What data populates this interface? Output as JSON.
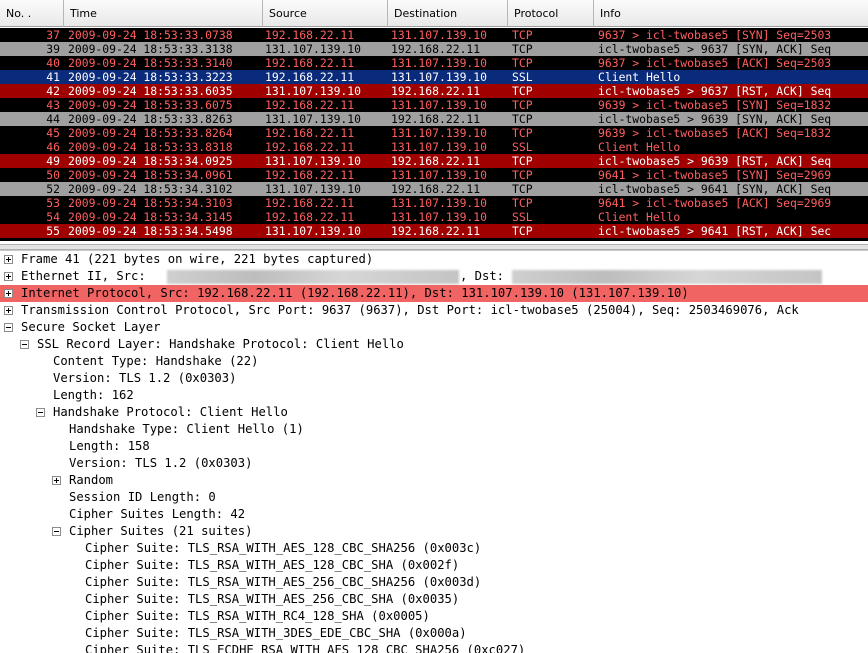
{
  "packet_list": {
    "columns": [
      {
        "label": "No. ."
      },
      {
        "label": "Time"
      },
      {
        "label": "Source"
      },
      {
        "label": "Destination"
      },
      {
        "label": "Protocol"
      },
      {
        "label": "Info"
      }
    ],
    "rows": [
      {
        "no": "37",
        "time": "2009-09-24 18:53:33.0738",
        "src": "192.168.22.11",
        "dst": "131.107.139.10",
        "proto": "TCP",
        "info": "9637 > icl-twobase5 [SYN] Seq=2503",
        "bg": "#000000",
        "fg": "#ff5f5f"
      },
      {
        "no": "39",
        "time": "2009-09-24 18:53:33.3138",
        "src": "131.107.139.10",
        "dst": "192.168.22.11",
        "proto": "TCP",
        "info": "icl-twobase5 > 9637 [SYN, ACK] Seq",
        "bg": "#a0a0a0",
        "fg": "#000000"
      },
      {
        "no": "40",
        "time": "2009-09-24 18:53:33.3140",
        "src": "192.168.22.11",
        "dst": "131.107.139.10",
        "proto": "TCP",
        "info": "9637 > icl-twobase5 [ACK] Seq=2503",
        "bg": "#000000",
        "fg": "#ff5f5f"
      },
      {
        "no": "41",
        "time": "2009-09-24 18:53:33.3223",
        "src": "192.168.22.11",
        "dst": "131.107.139.10",
        "proto": "SSL",
        "info": "Client Hello",
        "bg": "#0a2a7c",
        "fg": "#ffffff"
      },
      {
        "no": "42",
        "time": "2009-09-24 18:53:33.6035",
        "src": "131.107.139.10",
        "dst": "192.168.22.11",
        "proto": "TCP",
        "info": "icl-twobase5 > 9637 [RST, ACK] Seq",
        "bg": "#a00000",
        "fg": "#ffffff"
      },
      {
        "no": "43",
        "time": "2009-09-24 18:53:33.6075",
        "src": "192.168.22.11",
        "dst": "131.107.139.10",
        "proto": "TCP",
        "info": "9639 > icl-twobase5 [SYN] Seq=1832",
        "bg": "#000000",
        "fg": "#ff5f5f"
      },
      {
        "no": "44",
        "time": "2009-09-24 18:53:33.8263",
        "src": "131.107.139.10",
        "dst": "192.168.22.11",
        "proto": "TCP",
        "info": "icl-twobase5 > 9639 [SYN, ACK] Seq",
        "bg": "#a0a0a0",
        "fg": "#000000"
      },
      {
        "no": "45",
        "time": "2009-09-24 18:53:33.8264",
        "src": "192.168.22.11",
        "dst": "131.107.139.10",
        "proto": "TCP",
        "info": "9639 > icl-twobase5 [ACK] Seq=1832",
        "bg": "#000000",
        "fg": "#ff5f5f"
      },
      {
        "no": "46",
        "time": "2009-09-24 18:53:33.8318",
        "src": "192.168.22.11",
        "dst": "131.107.139.10",
        "proto": "SSL",
        "info": "Client Hello",
        "bg": "#000000",
        "fg": "#ff5f5f"
      },
      {
        "no": "49",
        "time": "2009-09-24 18:53:34.0925",
        "src": "131.107.139.10",
        "dst": "192.168.22.11",
        "proto": "TCP",
        "info": "icl-twobase5 > 9639 [RST, ACK] Seq",
        "bg": "#a00000",
        "fg": "#ffffff"
      },
      {
        "no": "50",
        "time": "2009-09-24 18:53:34.0961",
        "src": "192.168.22.11",
        "dst": "131.107.139.10",
        "proto": "TCP",
        "info": "9641 > icl-twobase5 [SYN] Seq=2969",
        "bg": "#000000",
        "fg": "#ff5f5f"
      },
      {
        "no": "52",
        "time": "2009-09-24 18:53:34.3102",
        "src": "131.107.139.10",
        "dst": "192.168.22.11",
        "proto": "TCP",
        "info": "icl-twobase5 > 9641 [SYN, ACK] Seq",
        "bg": "#a0a0a0",
        "fg": "#000000"
      },
      {
        "no": "53",
        "time": "2009-09-24 18:53:34.3103",
        "src": "192.168.22.11",
        "dst": "131.107.139.10",
        "proto": "TCP",
        "info": "9641 > icl-twobase5 [ACK] Seq=2969",
        "bg": "#000000",
        "fg": "#ff5f5f"
      },
      {
        "no": "54",
        "time": "2009-09-24 18:53:34.3145",
        "src": "192.168.22.11",
        "dst": "131.107.139.10",
        "proto": "SSL",
        "info": "Client Hello",
        "bg": "#000000",
        "fg": "#ff5f5f"
      },
      {
        "no": "55",
        "time": "2009-09-24 18:53:34.5498",
        "src": "131.107.139.10",
        "dst": "192.168.22.11",
        "proto": "TCP",
        "info": "icl-twobase5 > 9641 [RST, ACK] Sec",
        "bg": "#a00000",
        "fg": "#ffffff"
      }
    ]
  },
  "details": {
    "highlight_color": "#f06464",
    "rows": [
      {
        "depth": 0,
        "expander": "plus",
        "text": "Frame 41 (221 bytes on wire, 221 bytes captured)",
        "highlight": false
      },
      {
        "depth": 0,
        "expander": "plus",
        "text": "Ethernet II, Src:",
        "text2": ", Dst:",
        "highlight": false
      },
      {
        "depth": 0,
        "expander": "plus",
        "text": "Internet Protocol, Src: 192.168.22.11 (192.168.22.11), Dst: 131.107.139.10 (131.107.139.10)",
        "highlight": true
      },
      {
        "depth": 0,
        "expander": "plus",
        "text": "Transmission Control Protocol, Src Port: 9637 (9637), Dst Port: icl-twobase5 (25004), Seq: 2503469076, Ack",
        "highlight": false
      },
      {
        "depth": 0,
        "expander": "minus",
        "text": "Secure Socket Layer",
        "highlight": false
      },
      {
        "depth": 1,
        "expander": "minus",
        "text": "SSL Record Layer: Handshake Protocol: Client Hello",
        "highlight": false
      },
      {
        "depth": 2,
        "expander": "none",
        "text": "Content Type: Handshake (22)",
        "highlight": false
      },
      {
        "depth": 2,
        "expander": "none",
        "text": "Version: TLS 1.2 (0x0303)",
        "highlight": false
      },
      {
        "depth": 2,
        "expander": "none",
        "text": "Length: 162",
        "highlight": false
      },
      {
        "depth": 2,
        "expander": "minus",
        "text": "Handshake Protocol: Client Hello",
        "highlight": false
      },
      {
        "depth": 3,
        "expander": "none",
        "text": "Handshake Type: Client Hello (1)",
        "highlight": false
      },
      {
        "depth": 3,
        "expander": "none",
        "text": "Length: 158",
        "highlight": false
      },
      {
        "depth": 3,
        "expander": "none",
        "text": "Version: TLS 1.2 (0x0303)",
        "highlight": false
      },
      {
        "depth": 3,
        "expander": "plus",
        "text": "Random",
        "highlight": false
      },
      {
        "depth": 3,
        "expander": "none",
        "text": "Session ID Length: 0",
        "highlight": false
      },
      {
        "depth": 3,
        "expander": "none",
        "text": "Cipher Suites Length: 42",
        "highlight": false
      },
      {
        "depth": 3,
        "expander": "minus",
        "text": "Cipher Suites (21 suites)",
        "highlight": false
      },
      {
        "depth": 4,
        "expander": "none",
        "text": "Cipher Suite: TLS_RSA_WITH_AES_128_CBC_SHA256 (0x003c)",
        "highlight": false
      },
      {
        "depth": 4,
        "expander": "none",
        "text": "Cipher Suite: TLS_RSA_WITH_AES_128_CBC_SHA (0x002f)",
        "highlight": false
      },
      {
        "depth": 4,
        "expander": "none",
        "text": "Cipher Suite: TLS_RSA_WITH_AES_256_CBC_SHA256 (0x003d)",
        "highlight": false
      },
      {
        "depth": 4,
        "expander": "none",
        "text": "Cipher Suite: TLS_RSA_WITH_AES_256_CBC_SHA (0x0035)",
        "highlight": false
      },
      {
        "depth": 4,
        "expander": "none",
        "text": "Cipher Suite: TLS_RSA_WITH_RC4_128_SHA (0x0005)",
        "highlight": false
      },
      {
        "depth": 4,
        "expander": "none",
        "text": "Cipher Suite: TLS_RSA_WITH_3DES_EDE_CBC_SHA (0x000a)",
        "highlight": false
      },
      {
        "depth": 4,
        "expander": "none",
        "text": "Cipher Suite: TLS_ECDHE_RSA_WITH_AES_128_CBC_SHA256 (0xc027)",
        "highlight": false
      }
    ]
  }
}
